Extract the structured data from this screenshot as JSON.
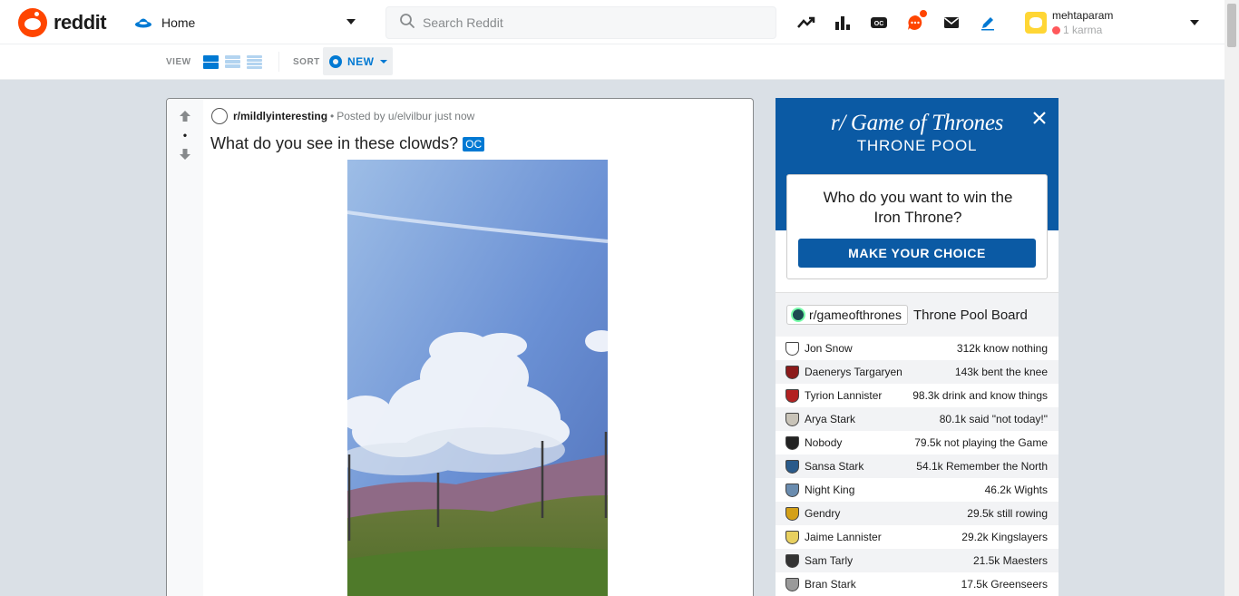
{
  "header": {
    "brand": "reddit",
    "feed_label": "Home",
    "search_placeholder": "Search Reddit",
    "username": "mehtaparam",
    "karma": "1 karma",
    "icons": [
      "popular-icon",
      "stats-icon",
      "coins-icon",
      "chat-icon",
      "mail-icon",
      "pencil-icon"
    ]
  },
  "sortbar": {
    "view_label": "VIEW",
    "sort_label": "SORT",
    "sort_value": "NEW"
  },
  "post": {
    "vote_count": "•",
    "subreddit": "r/mildlyinteresting",
    "separator": "•",
    "posted_by": "Posted by u/elvilbur just now",
    "title": "What do you see in these clowds?",
    "flair": "OC"
  },
  "sidebar": {
    "brand_line1": "r/ Game of Thrones",
    "brand_line2": "THRONE POOL",
    "question": "Who do you want to win the Iron Throne?",
    "cta": "MAKE YOUR CHOICE",
    "board_sub": "r/gameofthrones",
    "board_title": "Throne Pool Board",
    "candidates": [
      {
        "name": "Jon Snow",
        "stat": "312k know nothing",
        "color": "#ffffff"
      },
      {
        "name": "Daenerys Targaryen",
        "stat": "143k bent the knee",
        "color": "#8b1a1a"
      },
      {
        "name": "Tyrion Lannister",
        "stat": "98.3k drink and know things",
        "color": "#b22222"
      },
      {
        "name": "Arya Stark",
        "stat": "80.1k said \"not today!\"",
        "color": "#c8c3b8"
      },
      {
        "name": "Nobody",
        "stat": "79.5k not playing the Game",
        "color": "#222222"
      },
      {
        "name": "Sansa Stark",
        "stat": "54.1k Remember the North",
        "color": "#2a5a8a"
      },
      {
        "name": "Night King",
        "stat": "46.2k Wights",
        "color": "#6a8caf"
      },
      {
        "name": "Gendry",
        "stat": "29.5k still rowing",
        "color": "#d4a017"
      },
      {
        "name": "Jaime Lannister",
        "stat": "29.2k Kingslayers",
        "color": "#e8d060"
      },
      {
        "name": "Sam Tarly",
        "stat": "21.5k Maesters",
        "color": "#333333"
      },
      {
        "name": "Bran Stark",
        "stat": "17.5k Greenseers",
        "color": "#9a9a9a"
      }
    ]
  },
  "colors": {
    "accent": "#0079d3",
    "brand_orange": "#ff4500",
    "got_blue": "#0b5aa4"
  }
}
